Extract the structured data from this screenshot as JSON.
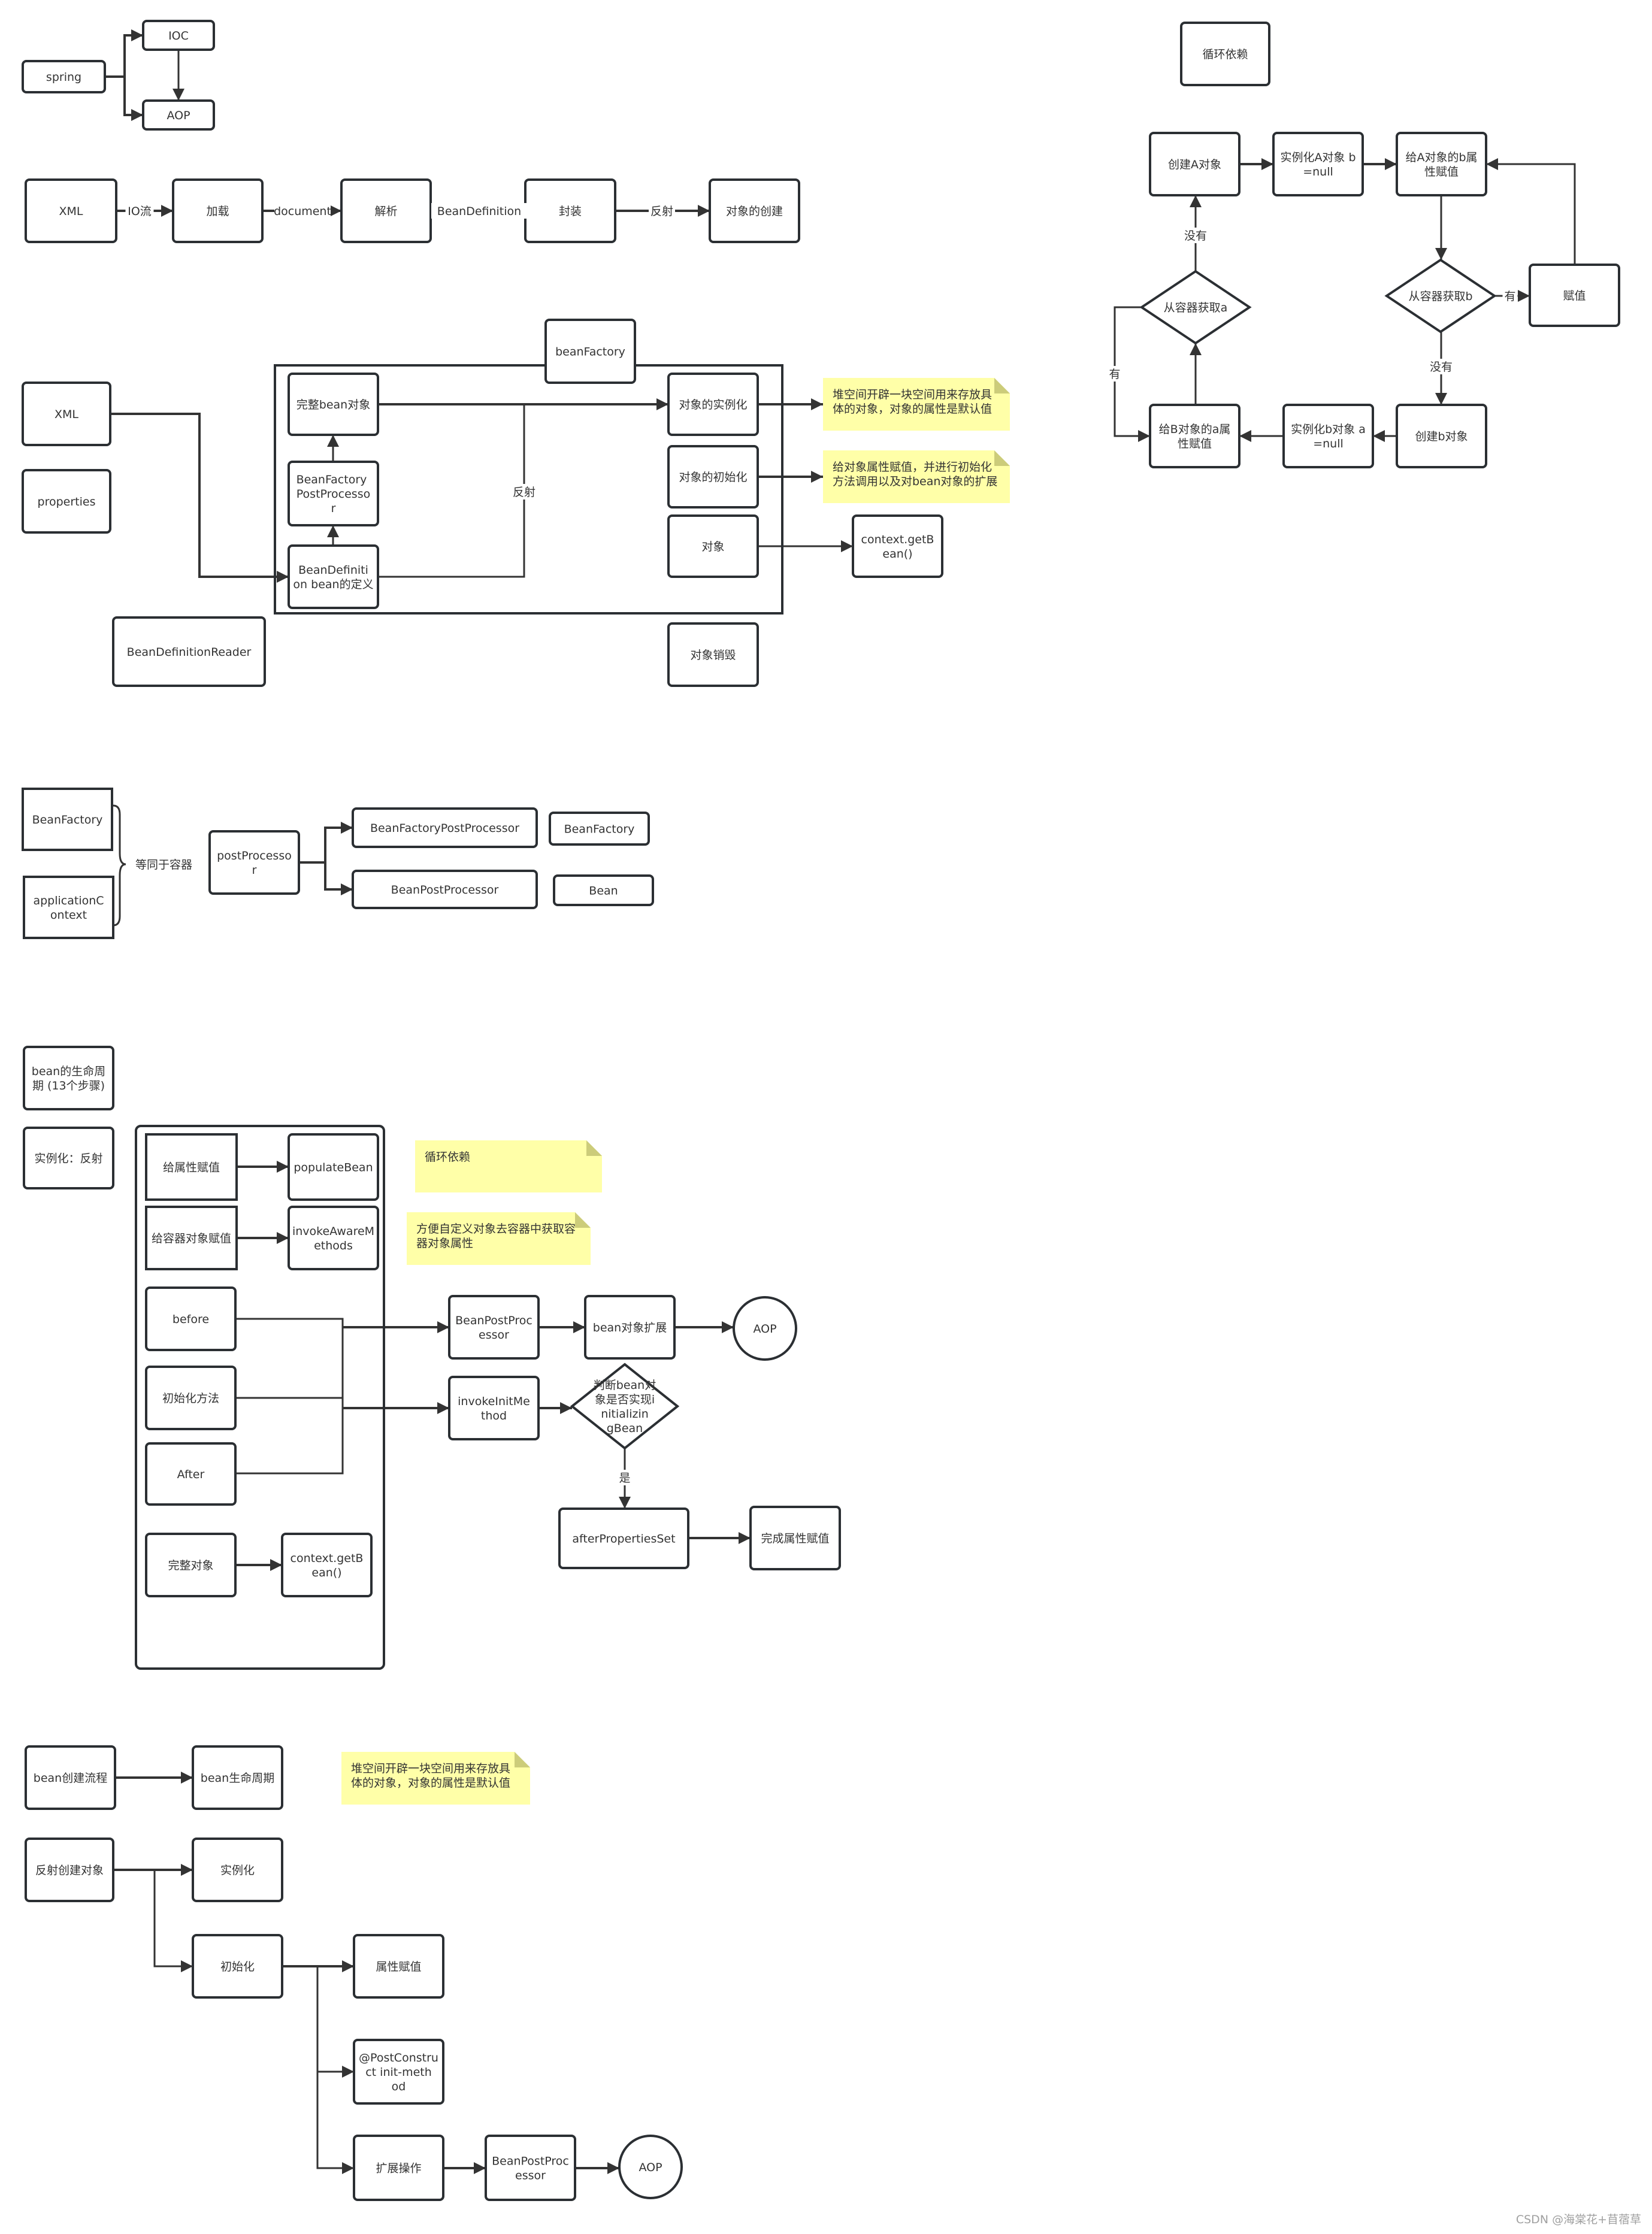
{
  "colors": {
    "stroke": "#2b2f33",
    "note_fill": "#ffffa8",
    "note_fold": "#cccc7a",
    "background": "#ffffff"
  },
  "spring_overview": {
    "nodes": {
      "spring": "spring",
      "ioc": "IOC",
      "aop": "AOP"
    }
  },
  "xml_pipeline": {
    "nodes": [
      "XML",
      "加载",
      "解析",
      "封装",
      "对象的创建"
    ],
    "edges": [
      "IO流",
      "document",
      "BeanDefinition",
      "反射"
    ]
  },
  "bean_factory": {
    "container_title": "beanFactory",
    "sources": [
      "XML",
      "properties"
    ],
    "reader": "BeanDefinitionReader",
    "inner": {
      "complete_bean": "完整bean对象",
      "bfpp": "BeanFactory PostProcessor",
      "bean_definition": "BeanDefinition bean的定义"
    },
    "stages": [
      "对象的实例化",
      "对象的初始化",
      "对象"
    ],
    "destroy": "对象销毁",
    "reflect_label": "反射",
    "get_bean": "context.getBean()",
    "notes": [
      "堆空间开辟一块空间用来存放具体的对象，对象的属性是默认值",
      "给对象属性赋值，并进行初始化方法调用以及对bean对象的扩展"
    ]
  },
  "circular_dependency": {
    "title": "循环依赖",
    "nodes": {
      "create_a": "创建A对象",
      "inst_a": "实例化A对象 b=null",
      "assign_a_b": "给A对象的b属性赋值",
      "get_b": "从容器获取b",
      "assign": "赋值",
      "create_b": "创建b对象",
      "inst_b": "实例化b对象 a=null",
      "assign_b_a": "给B对象的a属性赋值",
      "get_a": "从容器获取a"
    },
    "edge_labels": {
      "none_a": "没有",
      "none_b": "没有",
      "has_a": "有",
      "has_b": "有"
    }
  },
  "containers": {
    "left": [
      "BeanFactory",
      "applicationContext"
    ],
    "brace_label": "等同于容器",
    "post_processor": "postProcessor",
    "targets": [
      "BeanFactoryPostProcessor",
      "BeanPostProcessor"
    ],
    "applies_to": [
      "BeanFactory",
      "Bean"
    ]
  },
  "lifecycle": {
    "title": "bean的生命周期 (13个步骤)",
    "instantiate": "实例化：反射",
    "steps": [
      {
        "label": "给属性赋值",
        "method": "populateBean"
      },
      {
        "label": "给容器对象赋值",
        "method": "invokeAwareMethods"
      }
    ],
    "before": "before",
    "init_method": "初始化方法",
    "after": "After",
    "complete": "完整对象",
    "get_bean": "context.getBean()",
    "bpp": "BeanPostProcessor",
    "bean_ext": "bean对象扩展",
    "aop": "AOP",
    "invoke_init": "invokeInitMethod",
    "decision": "判断bean对象是否实现initializingBean",
    "yes": "是",
    "after_props": "afterPropertiesSet",
    "done": "完成属性赋值",
    "notes": [
      "循环依赖",
      "方便自定义对象去容器中获取容器对象属性"
    ]
  },
  "creation_flow": {
    "flow": "bean创建流程",
    "lifecycle": "bean生命周期",
    "note": "堆空间开辟一块空间用来存放具体的对象，对象的属性是默认值",
    "reflect_create": "反射创建对象",
    "instantiate": "实例化",
    "initialize": "初始化",
    "children": [
      "属性赋值",
      "@PostConstruct init-method",
      "扩展操作"
    ],
    "bpp": "BeanPostProcessor",
    "aop": "AOP"
  },
  "watermark": "CSDN @海棠花+苜蓿草"
}
